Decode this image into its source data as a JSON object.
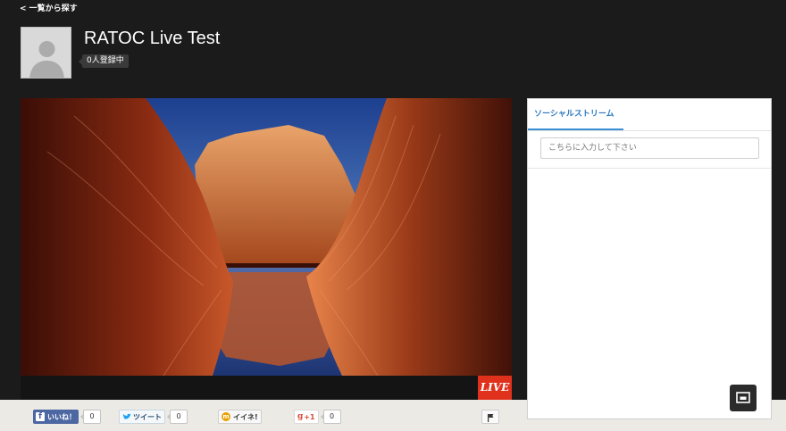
{
  "nav": {
    "back_label": "< 一覧から探す"
  },
  "channel": {
    "title": "RATOC Live Test",
    "subscribers": "0人登録中"
  },
  "player": {
    "live_label": "LIVE"
  },
  "share": {
    "facebook": {
      "label": "いいね！",
      "count": "0"
    },
    "twitter": {
      "label": "ツイート",
      "count": "0"
    },
    "mixi": {
      "label": "イイネ!"
    },
    "google_plus": {
      "label": "+1",
      "count": "0"
    }
  },
  "social_stream": {
    "tab_label": "ソーシャルストリーム",
    "input_placeholder": "こちらに入力して下さい"
  },
  "colors": {
    "live": "#e0311d",
    "facebook": "#4c67a1",
    "tab_accent": "#3b8fd5"
  },
  "icons": [
    "back-chevron-icon",
    "default-avatar-icon",
    "facebook-icon",
    "twitter-bird-icon",
    "mixi-icon",
    "google-plus-icon",
    "flag-icon",
    "popout-icon"
  ]
}
